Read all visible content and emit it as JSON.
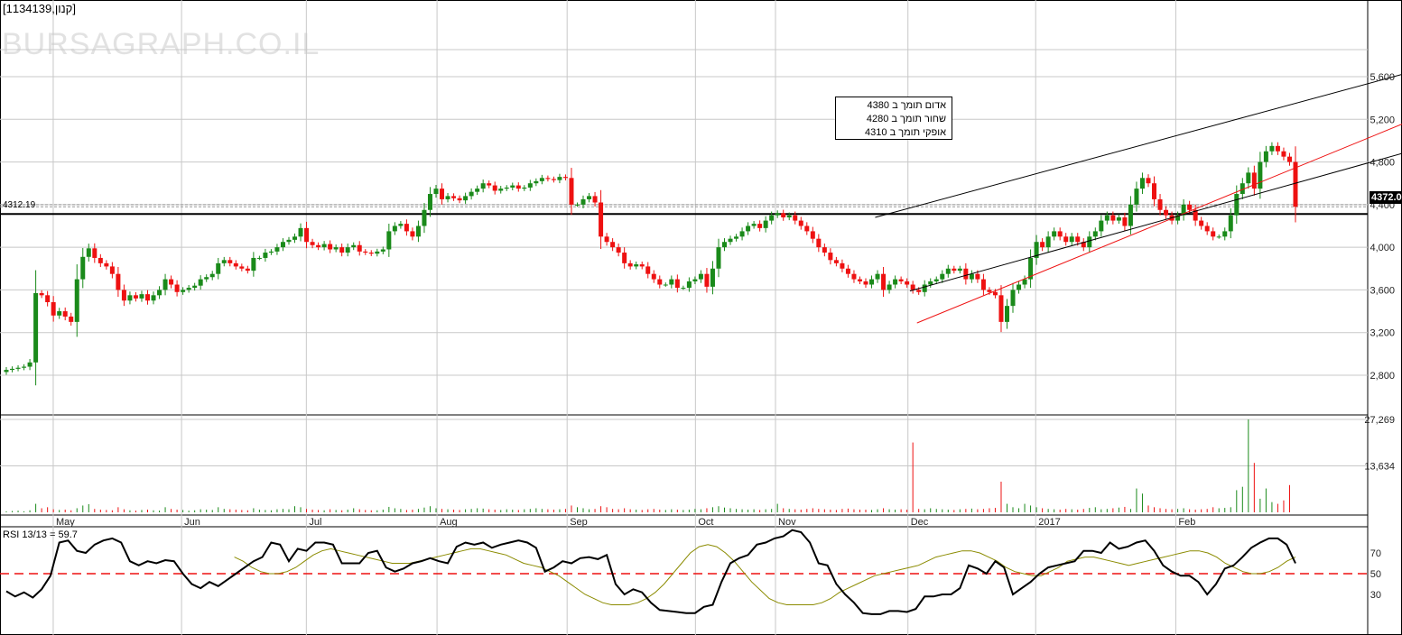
{
  "header": {
    "title": "[1134139,קנון]",
    "watermark": "BURSAGRAPH.CO.IL"
  },
  "annotation": [
    "אדום תומך ב 4380",
    "שחור תומך ב 4280",
    "אופקי תומך ב 4310"
  ],
  "horizontal_line_label": "4312.19",
  "last_price_label": "4372.0",
  "rsi_label": "RSI 13/13 = 59.7",
  "colors": {
    "up": "#1a8a1a",
    "down": "#ee1111",
    "rsi": "#000000",
    "rsi_ma": "#8b8b00",
    "ref": "#ee1111"
  },
  "chart_data": {
    "type": "candlestick",
    "title": "[1134139,קנון]",
    "price_ticks": [
      "2,800",
      "3,200",
      "3,600",
      "4,000",
      "4,400",
      "4,800",
      "5,200",
      "5,600"
    ],
    "price_tick_values": [
      2800,
      3200,
      3600,
      4000,
      4400,
      4800,
      5200,
      5600
    ],
    "volume_ticks": [
      "13,634",
      "27,269"
    ],
    "volume_tick_values": [
      13634,
      27269
    ],
    "rsi_ticks": [
      "30",
      "50",
      "70"
    ],
    "rsi_tick_values": [
      30,
      50,
      70
    ],
    "months": [
      {
        "label": "May",
        "index": 9.5
      },
      {
        "label": "Jun",
        "index": 31.3
      },
      {
        "label": "Jul",
        "index": 52.5
      },
      {
        "label": "Aug",
        "index": 74.7
      },
      {
        "label": "Sep",
        "index": 96.8
      },
      {
        "label": "Oct",
        "index": 118.6
      },
      {
        "label": "Nov",
        "index": 132.2
      },
      {
        "label": "Dec",
        "index": 154.7
      },
      {
        "label": "2017",
        "index": 176.4
      },
      {
        "label": "Feb",
        "index": 200.2
      }
    ],
    "first_open": 2830,
    "closes": [
      2850,
      2860,
      2870,
      2880,
      2920,
      3570,
      3550,
      3485,
      3360,
      3400,
      3350,
      3300,
      3700,
      3910,
      3990,
      3900,
      3850,
      3820,
      3750,
      3600,
      3500,
      3550,
      3520,
      3560,
      3500,
      3550,
      3600,
      3700,
      3650,
      3580,
      3600,
      3620,
      3640,
      3700,
      3720,
      3750,
      3850,
      3880,
      3850,
      3820,
      3800,
      3780,
      3900,
      3900,
      3950,
      3960,
      4000,
      4050,
      4070,
      4100,
      4180,
      4050,
      4020,
      4000,
      4030,
      3980,
      4000,
      3950,
      4000,
      4020,
      3960,
      3950,
      3940,
      3960,
      3980,
      4150,
      4200,
      4220,
      4150,
      4100,
      4200,
      4350,
      4500,
      4550,
      4450,
      4480,
      4460,
      4440,
      4480,
      4520,
      4550,
      4600,
      4580,
      4530,
      4550,
      4560,
      4580,
      4550,
      4560,
      4600,
      4620,
      4650,
      4640,
      4630,
      4660,
      4650,
      4400,
      4400,
      4450,
      4480,
      4420,
      4100,
      4050,
      4000,
      3950,
      3850,
      3820,
      3840,
      3820,
      3750,
      3700,
      3650,
      3650,
      3700,
      3620,
      3620,
      3680,
      3700,
      3750,
      3630,
      3800,
      4000,
      4050,
      4080,
      4100,
      4150,
      4200,
      4220,
      4180,
      4250,
      4300,
      4320,
      4280,
      4300,
      4250,
      4200,
      4150,
      4080,
      4000,
      3950,
      3880,
      3850,
      3800,
      3750,
      3700,
      3680,
      3650,
      3700,
      3750,
      3600,
      3650,
      3700,
      3680,
      3650,
      3600,
      3580,
      3650,
      3680,
      3700,
      3750,
      3800,
      3780,
      3800,
      3700,
      3750,
      3700,
      3600,
      3580,
      3550,
      3300,
      3450,
      3600,
      3650,
      3700,
      3900,
      4050,
      4000,
      4100,
      4150,
      4100,
      4050,
      4100,
      4050,
      4000,
      4100,
      4150,
      4250,
      4300,
      4250,
      4280,
      4200,
      4400,
      4550,
      4650,
      4600,
      4450,
      4350,
      4300,
      4250,
      4300,
      4400,
      4350,
      4250,
      4200,
      4150,
      4100,
      4100,
      4150,
      4300,
      4500,
      4600,
      4700,
      4550,
      4800,
      4900,
      4950,
      4900,
      4850,
      4800,
      4380
    ],
    "volume": [
      300,
      400,
      500,
      300,
      600,
      2500,
      1200,
      1500,
      900,
      700,
      800,
      600,
      1200,
      2000,
      2400,
      1000,
      800,
      700,
      600,
      1500,
      900,
      600,
      500,
      700,
      800,
      600,
      500,
      1500,
      1000,
      800,
      700,
      500,
      600,
      900,
      800,
      700,
      1500,
      1000,
      900,
      800,
      700,
      600,
      1200,
      800,
      700,
      600,
      900,
      1000,
      900,
      1800,
      1500,
      1000,
      800,
      700,
      600,
      900,
      700,
      600,
      800,
      1200,
      900,
      700,
      600,
      600,
      800,
      1600,
      1200,
      1000,
      700,
      800,
      1000,
      1400,
      1800,
      1200,
      1000,
      900,
      800,
      700,
      900,
      1000,
      1200,
      1100,
      900,
      800,
      700,
      900,
      800,
      700,
      900,
      1000,
      1200,
      1000,
      900,
      800,
      900,
      1000,
      2000,
      1500,
      1200,
      900,
      1000,
      1800,
      1500,
      1000,
      900,
      1200,
      900,
      800,
      700,
      900,
      1000,
      800,
      700,
      900,
      800,
      700,
      800,
      1000,
      900,
      1200,
      1500,
      1800,
      1400,
      1200,
      1000,
      900,
      800,
      900,
      700,
      900,
      1000,
      2500,
      1200,
      1000,
      900,
      800,
      1000,
      1200,
      1000,
      900,
      800,
      700,
      1000,
      1100,
      900,
      800,
      800,
      700,
      900,
      1200,
      900,
      800,
      900,
      800,
      20500,
      1000,
      900,
      1200,
      1000,
      900,
      800,
      700,
      900,
      1000,
      1100,
      900,
      1000,
      1200,
      1300,
      9000,
      2500,
      1500,
      1200,
      2500,
      2000,
      1500,
      1200,
      1000,
      900,
      800,
      1000,
      900,
      800,
      1000,
      1300,
      1500,
      900,
      1000,
      1200,
      1400,
      1600,
      1000,
      7000,
      5500,
      2000,
      1500,
      1200,
      1000,
      900,
      1000,
      1200,
      900,
      800,
      900,
      1000,
      1500,
      1200,
      1300,
      1500,
      6500,
      7500,
      27269,
      14500,
      4000,
      7000,
      3000,
      2500,
      3500,
      8000
    ],
    "rsi": [
      33,
      28,
      32,
      27,
      35,
      48,
      80,
      82,
      72,
      70,
      78,
      82,
      84,
      80,
      62,
      58,
      62,
      60,
      63,
      62,
      50,
      40,
      36,
      42,
      38,
      44,
      50,
      56,
      62,
      66,
      80,
      78,
      62,
      74,
      72,
      80,
      80,
      78,
      60,
      60,
      60,
      70,
      72,
      56,
      52,
      55,
      60,
      62,
      65,
      62,
      60,
      76,
      80,
      78,
      80,
      75,
      78,
      80,
      82,
      80,
      75,
      52,
      56,
      62,
      60,
      65,
      66,
      64,
      68,
      40,
      30,
      35,
      32,
      22,
      15,
      14,
      13,
      12,
      12,
      18,
      20,
      42,
      60,
      65,
      68,
      78,
      80,
      84,
      86,
      92,
      90,
      80,
      60,
      58,
      40,
      30,
      22,
      12,
      11,
      11,
      14,
      14,
      13,
      16,
      28,
      28,
      30,
      30,
      36,
      58,
      55,
      50,
      62,
      56,
      30,
      36,
      42,
      50,
      56,
      58,
      60,
      62,
      72,
      72,
      70,
      80,
      74,
      76,
      80,
      82,
      72,
      58,
      52,
      48,
      48,
      42,
      30,
      40,
      55,
      58,
      66,
      75,
      80,
      84,
      84,
      78,
      60
    ],
    "rsi_ma": [
      null,
      null,
      null,
      null,
      null,
      null,
      null,
      null,
      null,
      null,
      null,
      null,
      null,
      null,
      null,
      null,
      null,
      null,
      null,
      null,
      null,
      null,
      null,
      null,
      null,
      null,
      66,
      62,
      56,
      52,
      50,
      50,
      52,
      56,
      62,
      68,
      72,
      74,
      72,
      70,
      68,
      66,
      64,
      62,
      60,
      60,
      60,
      62,
      64,
      66,
      68,
      70,
      72,
      74,
      74,
      72,
      70,
      68,
      64,
      60,
      58,
      56,
      52,
      48,
      42,
      36,
      30,
      26,
      22,
      20,
      20,
      20,
      22,
      26,
      32,
      40,
      50,
      60,
      70,
      76,
      78,
      76,
      70,
      62,
      52,
      42,
      34,
      26,
      22,
      20,
      20,
      20,
      20,
      22,
      26,
      32,
      36,
      40,
      44,
      48,
      50,
      52,
      54,
      56,
      58,
      62,
      66,
      68,
      70,
      72,
      72,
      70,
      66,
      62,
      56,
      52,
      50,
      48,
      48,
      52,
      56,
      62,
      64,
      66,
      66,
      64,
      62,
      60,
      58,
      60,
      62,
      64,
      66,
      68,
      70,
      72,
      72,
      70,
      66,
      60,
      56,
      52,
      50,
      50,
      52,
      56,
      62,
      66
    ],
    "rsi_reference": 50,
    "horizontal_line": 4312.19,
    "dashed_lines": [
      4380,
      4400
    ],
    "trendlines": [
      {
        "name": "red-support",
        "color": "red",
        "from": [
          154.7,
          3290
        ],
        "to": [
          217,
          4700
        ]
      },
      {
        "name": "black-upper",
        "color": "black",
        "from": [
          147.6,
          4280
        ],
        "to": [
          215,
          5290
        ]
      },
      {
        "name": "black-lower",
        "color": "black",
        "from": [
          153.5,
          3590
        ],
        "to": [
          217,
          4570
        ]
      }
    ]
  }
}
